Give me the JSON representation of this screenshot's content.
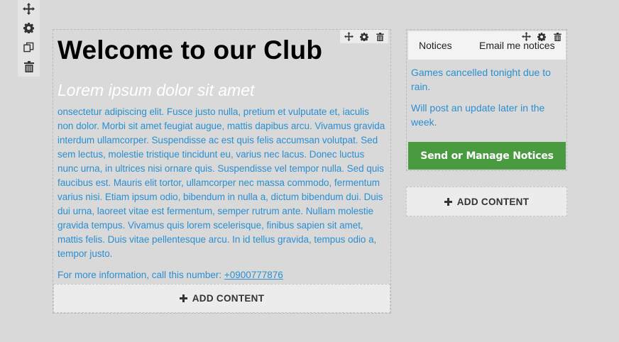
{
  "toolbar": {
    "icons": [
      "move-icon",
      "gear-icon",
      "copy-icon",
      "trash-icon"
    ]
  },
  "main": {
    "title": "Welcome to our Club",
    "subtitle": "Lorem ipsum dolor sit amet",
    "body": "onsectetur adipiscing elit. Fusce justo nulla, pretium et vulputate et, iaculis non dolor. Morbi sit amet feugiat augue, mattis dapibus arcu. Vivamus gravida interdum ullamcorper. Suspendisse ac est quis felis accumsan volutpat. Sed sem lectus, molestie tristique tincidunt eu, varius nec lacus. Donec luctus nunc urna, in ultrices nisi ornare quis. Suspendisse vel tempor nulla. Sed quis faucibus est. Mauris elit tortor, ullamcorper nec massa commodo, fermentum varius nisi. Etiam ipsum odio, bibendum in nulla a, dictum bibendum dui. Duis dui urna, laoreet vitae est fermentum, semper rutrum ante. Nullam molestie gravida tempus. Vivamus quis lorem scelerisque, finibus sapien sit amet, mattis felis. Duis vitae pellentesque arcu. In id tellus gravida, tempus odio a, tempor justo.",
    "more_prefix": "For more information, call this number: ",
    "phone": "+0900777876",
    "add_content_label": "ADD CONTENT"
  },
  "notices": {
    "tabs": [
      "Notices",
      "Email me notices"
    ],
    "items": [
      "Games cancelled tonight due to rain.",
      "Will post an update later in the week."
    ],
    "button_label": "Send or Manage Notices",
    "add_content_label": "ADD CONTENT"
  },
  "colors": {
    "background": "#d9d9d9",
    "link": "#2b8fd0",
    "button_green": "#4a9a3f"
  }
}
